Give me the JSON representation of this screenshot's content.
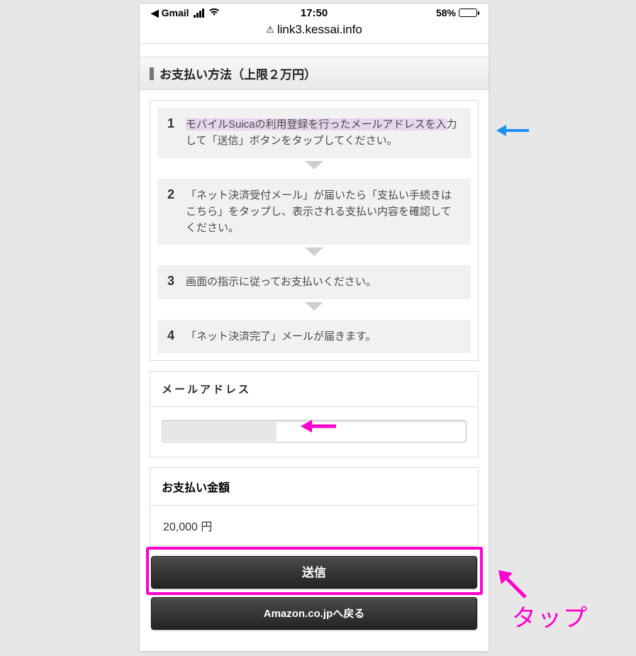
{
  "status": {
    "back_app": "Gmail",
    "time": "17:50",
    "battery_pct": "58%"
  },
  "url": "link3.kessai.info",
  "header": {
    "title": "お支払い方法（上限２万円）"
  },
  "steps": [
    {
      "num": "1",
      "text_hl": "モバイルSuicaの利用登録を行ったメールアドレスを入",
      "text_rest": "力して「送信」ボタンをタップしてください。"
    },
    {
      "num": "2",
      "text": "「ネット決済受付メール」が届いたら「支払い手続きはこちら」をタップし、表示される支払い内容を確認してください。"
    },
    {
      "num": "3",
      "text": "画面の指示に従ってお支払いください。"
    },
    {
      "num": "4",
      "text": "「ネット決済完了」メールが届きます。"
    }
  ],
  "email": {
    "label": "メールアドレス",
    "value": ""
  },
  "amount": {
    "label": "お支払い金額",
    "value": "20,000 円"
  },
  "buttons": {
    "submit": "送信",
    "back": "Amazon.co.jpへ戻る"
  },
  "annotations": {
    "tap_label": "タップ"
  }
}
